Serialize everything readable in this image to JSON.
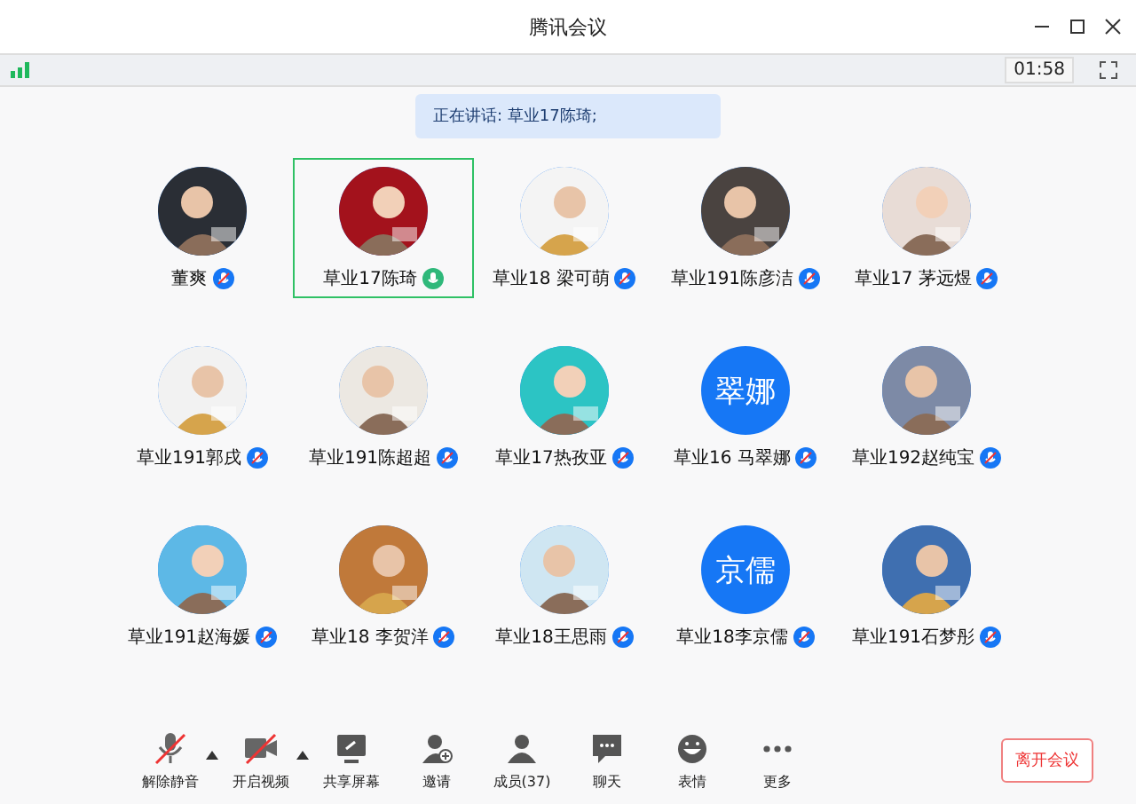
{
  "window": {
    "title": "腾讯会议"
  },
  "status_bar": {
    "timer": "01:58"
  },
  "speaking_banner": "正在讲话: 草业17陈琦;",
  "participants": [
    {
      "name": "董爽",
      "muted": true,
      "selected": false
    },
    {
      "name": "草业17陈琦",
      "muted": false,
      "selected": true
    },
    {
      "name": "草业18 梁可萌",
      "muted": true,
      "selected": false
    },
    {
      "name": "草业191陈彦洁",
      "muted": true,
      "selected": false
    },
    {
      "name": "草业17 茅远煜",
      "muted": true,
      "selected": false
    },
    {
      "name": "草业191郭戌",
      "muted": true,
      "selected": false
    },
    {
      "name": "草业191陈超超",
      "muted": true,
      "selected": false
    },
    {
      "name": "草业17热孜亚",
      "muted": true,
      "selected": false
    },
    {
      "name": "草业16 马翠娜",
      "muted": true,
      "selected": false,
      "avatar": {
        "kind": "text",
        "text": "翠娜"
      }
    },
    {
      "name": "草业192赵纯宝",
      "muted": true,
      "selected": false
    },
    {
      "name": "草业191赵海媛",
      "muted": true,
      "selected": false
    },
    {
      "name": "草业18 李贺洋",
      "muted": true,
      "selected": false
    },
    {
      "name": "草业18王思雨",
      "muted": true,
      "selected": false
    },
    {
      "name": "草业18李京儒",
      "muted": true,
      "selected": false,
      "avatar": {
        "kind": "text",
        "text": "京儒"
      }
    },
    {
      "name": "草业191石梦彤",
      "muted": true,
      "selected": false
    }
  ],
  "toolbar": [
    {
      "kind": "mic",
      "label": "解除静音",
      "off": true,
      "menu": true
    },
    {
      "kind": "camera",
      "label": "开启视频",
      "off": true,
      "menu": true
    },
    {
      "kind": "share",
      "label": "共享屏幕",
      "off": false,
      "menu": false
    },
    {
      "kind": "invite",
      "label": "邀请",
      "off": false,
      "menu": false
    },
    {
      "kind": "members",
      "label": "成员(37)",
      "off": false,
      "menu": false
    },
    {
      "kind": "chat",
      "label": "聊天",
      "off": false,
      "menu": false
    },
    {
      "kind": "emoji",
      "label": "表情",
      "off": false,
      "menu": false
    },
    {
      "kind": "more",
      "label": "更多",
      "off": false,
      "menu": false
    }
  ],
  "leave_button": "离开会议"
}
